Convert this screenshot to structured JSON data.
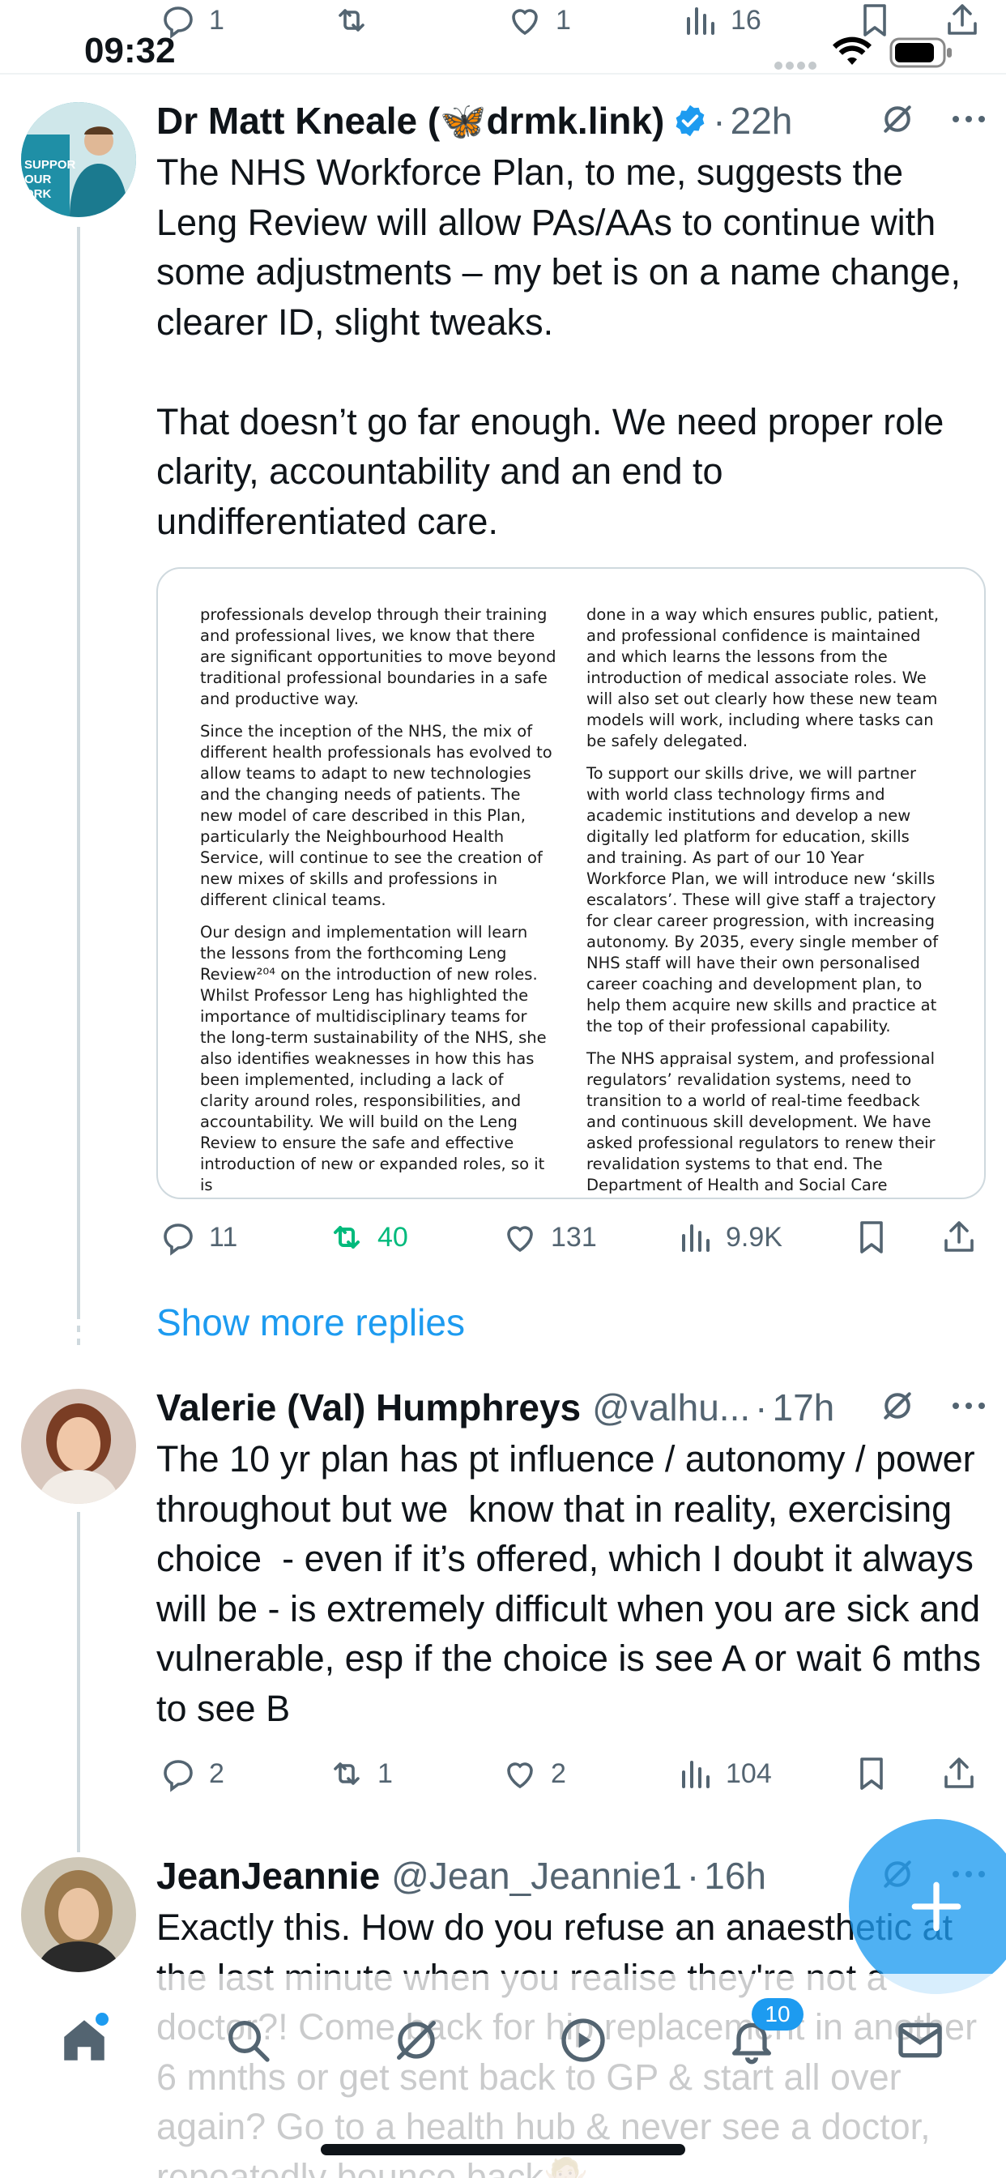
{
  "status_bar": {
    "time": "09:32"
  },
  "previous_tweet_actions": {
    "replies": "1",
    "reposts": "",
    "likes": "1",
    "views": "16"
  },
  "tweets": [
    {
      "display_name": "Dr Matt Kneale (🦋drmk.link)",
      "verified": true,
      "handle": "",
      "time": "22h",
      "text": "The NHS Workforce Plan, to me, suggests the Leng Review will allow PAs/AAs to continue with some adjustments – my bet is on a name change, clearer ID, slight tweaks.\n\nThat doesn’t go far enough. We need proper role clarity, accountability and an end to undifferentiated care.",
      "attachment": {
        "left_column": [
          "professionals develop through their training and professional lives, we know that there are significant opportunities to move beyond traditional professional boundaries in a safe and productive way.",
          "Since the inception of the NHS, the mix of different health professionals has evolved to allow teams to adapt to new technologies and the changing needs of patients. The new model of care described in this Plan, particularly the Neighbourhood Health Service, will continue to see the creation of new mixes of skills and professions in different clinical teams.",
          "Our design and implementation will learn the lessons from the forthcoming Leng Review²⁰⁴ on the introduction of new roles. Whilst Professor Leng has highlighted the importance of multidisciplinary teams for the long-term sustainability of the NHS, she also identifies weaknesses in how this has been implemented, including a lack of clarity around roles, responsibilities, and accountability. We will build on the Leng Review to ensure the safe and effective introduction of new or expanded roles, so it is"
        ],
        "right_column": [
          "done in a way which ensures public, patient, and professional confidence is maintained and which learns the lessons from the introduction of medical associate roles. We will also set out clearly how these new team models will work, including where tasks can be safely delegated.",
          "To support our skills drive, we will partner with world class technology firms and academic institutions and develop a new digitally led platform for education, skills and training. As part of our 10 Year Workforce Plan, we will introduce new ‘skills escalators’. These will give staff a trajectory for clear career progression, with increasing autonomy. By 2035, every single member of NHS staff will have their own personalised career coaching and development plan, to help them acquire new skills and practice at the top of their professional capability.",
          "The NHS appraisal system, and professional regulators’ revalidation systems, need to transition to a world of real-time feedback and continuous skill development. We have asked professional regulators to renew their revalidation systems to that end. The Department of Health and Social Care (DHSC)"
        ]
      },
      "actions": {
        "replies": "11",
        "reposts": "40",
        "likes": "131",
        "views": "9.9K"
      }
    },
    {
      "display_name": "Valerie (Val) Humphreys",
      "verified": false,
      "handle": "@valhu...",
      "time": "17h",
      "text": "The 10 yr plan has pt influence / autonomy / power throughout but we  know that in reality, exercising choice  - even if it’s offered, which I doubt it always will be - is extremely difficult when you are sick and vulnerable, esp if the choice is see A or wait 6 mths to see B",
      "actions": {
        "replies": "2",
        "reposts": "1",
        "likes": "2",
        "views": "104"
      }
    },
    {
      "display_name": "JeanJeannie",
      "verified": false,
      "handle": "@Jean_Jeannie1",
      "time": "16h",
      "text": "Exactly this. How do you refuse an anaesthetic at the last minute when you realise they're not a doctor?! Come back for hip replacement in another 6 mnths or get sent back to GP & start all over again? Go to a health hub & never see a doctor, repeatedly bounce back🤷🏼"
    }
  ],
  "show_more_replies": "Show more replies",
  "bottom_nav": {
    "notifications_badge": "10"
  },
  "colors": {
    "accent": "#1d9bf0",
    "repost_active": "#00ba7c",
    "muted": "#536471",
    "divider": "#cfd9de"
  }
}
